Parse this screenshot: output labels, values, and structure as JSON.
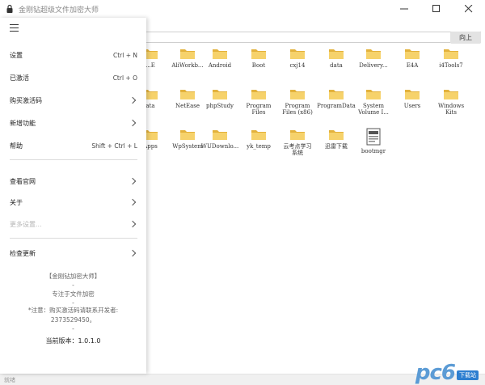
{
  "window": {
    "title": "金刚钻超级文件加密大师"
  },
  "toolbar": {
    "up_label": "向上"
  },
  "menu": {
    "items": [
      {
        "label": "设置",
        "shortcut": "Ctrl + N"
      },
      {
        "label": "已激活",
        "shortcut": "Ctrl + O"
      },
      {
        "label": "购买激活码",
        "shortcut": ""
      },
      {
        "label": "新增功能",
        "shortcut": ""
      },
      {
        "label": "帮助",
        "shortcut": "Shift + Ctrl + L"
      },
      {
        "label": "查看官网",
        "shortcut": ""
      },
      {
        "label": "关于",
        "shortcut": ""
      },
      {
        "label": "更多设置...",
        "shortcut": ""
      },
      {
        "label": "检查更新",
        "shortcut": ""
      }
    ]
  },
  "info": {
    "brand": "【金刚钻加密大师】",
    "dash1": "-",
    "tagline": "专注于文件加密",
    "dash2": "-",
    "notice": "*注意：购买激活码请联系开发者:",
    "contact": "2373529450。",
    "dash3": "-",
    "version": "当前版本：1.0.1.0"
  },
  "files": [
    {
      "name": "...E"
    },
    {
      "name": "AliWorkb..."
    },
    {
      "name": "Android"
    },
    {
      "name": "Boot"
    },
    {
      "name": "cxj14"
    },
    {
      "name": "data"
    },
    {
      "name": "Delivery..."
    },
    {
      "name": "E4A"
    },
    {
      "name": "i4Tools7"
    },
    {
      "name": "ata"
    },
    {
      "name": "NetEase"
    },
    {
      "name": "phpStudy"
    },
    {
      "name": "Program\nFiles"
    },
    {
      "name": "Program\nFiles (x86)"
    },
    {
      "name": "ProgramData"
    },
    {
      "name": "System\nVolume I..."
    },
    {
      "name": "Users"
    },
    {
      "name": "Windows\nKits"
    },
    {
      "name": "Apps"
    },
    {
      "name": "WpSystem"
    },
    {
      "name": "WUDownlo..."
    },
    {
      "name": "yk_temp"
    },
    {
      "name": "云考点学习\n系统"
    },
    {
      "name": "迅雷下载"
    },
    {
      "name": "bootmgr"
    }
  ],
  "status": {
    "text": "就绪"
  },
  "watermark": {
    "text": "pc6",
    "badge": "下载站"
  },
  "colors": {
    "folder": "#f6d26b",
    "folder_dark": "#e3b23c",
    "accent": "#2e7fd0"
  }
}
